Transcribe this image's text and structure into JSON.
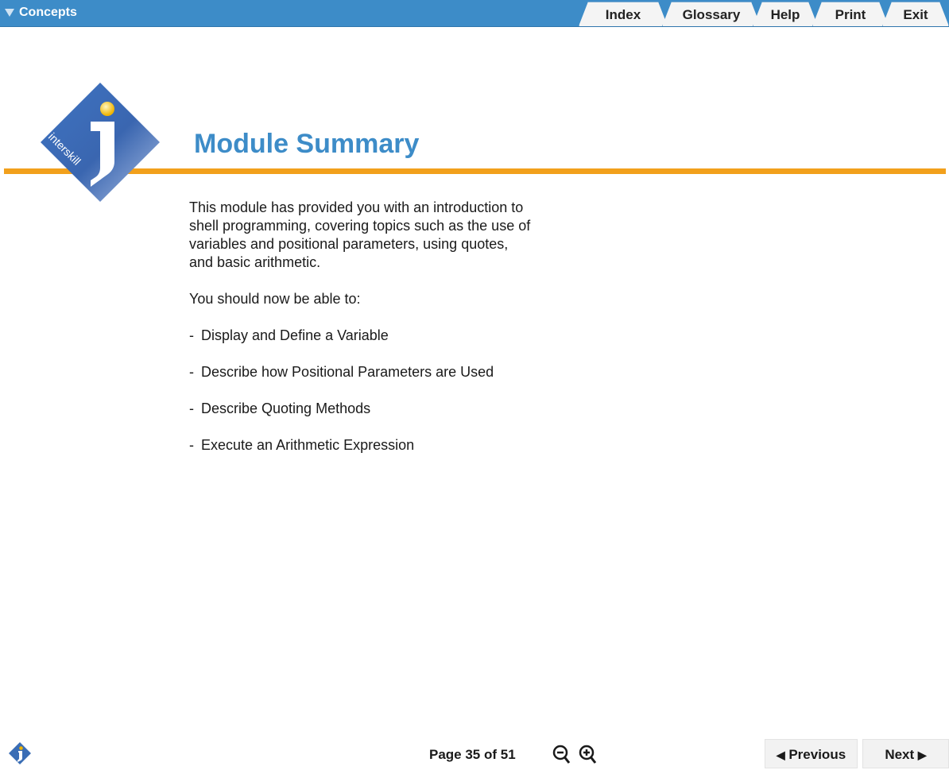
{
  "header": {
    "menu_label": "Concepts",
    "tabs": [
      {
        "id": "index",
        "label": "Index"
      },
      {
        "id": "glossary",
        "label": "Glossary"
      },
      {
        "id": "help",
        "label": "Help"
      },
      {
        "id": "print",
        "label": "Print"
      },
      {
        "id": "exit",
        "label": "Exit"
      }
    ]
  },
  "logo": {
    "text": "interskill",
    "icon": "interskill-logo-icon"
  },
  "main": {
    "title": "Module Summary",
    "intro_lines": [
      "This module has provided you with an introduction to",
      "shell programming, covering topics such as the use of",
      "variables and positional parameters, using quotes,",
      "and basic arithmetic."
    ],
    "lead": "You should now be able to:",
    "bullets": [
      "Display and Define a Variable",
      "Describe how Positional Parameters are Used",
      "Describe Quoting Methods",
      "Execute an Arithmetic Expression"
    ],
    "bullet_marker": "-"
  },
  "footer": {
    "page_label": "Page 35 of 51",
    "previous_label": "Previous",
    "next_label": "Next",
    "previous_arrow": "◀",
    "next_arrow": "▶",
    "icons": [
      "info-icon",
      "zoom-out-icon",
      "zoom-in-icon"
    ]
  },
  "colors": {
    "accent_blue": "#3d8cc8",
    "orange": "#f2a01c",
    "logo_blue": "#3a6db5"
  }
}
